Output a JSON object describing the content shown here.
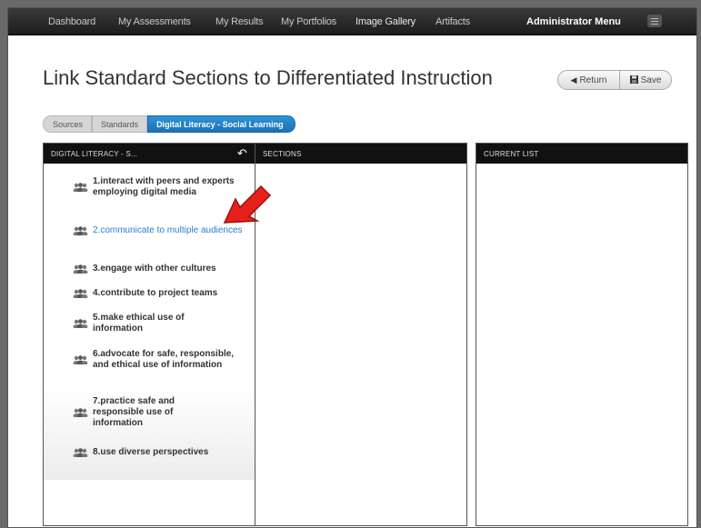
{
  "nav": {
    "items": [
      "Dashboard",
      "My Assessments",
      "My Results",
      "My Portfolios",
      "Image Gallery",
      "Artifacts"
    ],
    "admin_menu": "Administrator Menu"
  },
  "page": {
    "title": "Link Standard Sections to Differentiated Instruction",
    "return_label": "Return",
    "save_label": "Save"
  },
  "breadcrumb": [
    "Sources",
    "Standards",
    "Digital Literacy - Social Learning"
  ],
  "panels": {
    "left_header": "DIGITAL LITERACY - S...",
    "sections_header": "SECTIONS",
    "current_header": "CURRENT LIST"
  },
  "standards": [
    "1.interact with peers and experts employing digital media",
    "2.communicate to multiple audiences",
    "3.engage with other cultures",
    "4.contribute to project teams",
    "5.make ethical use of information",
    "6.advocate for safe, responsible, and ethical use of information",
    "7.practice safe and responsible use of information",
    "8.use diverse perspectives"
  ],
  "colors": {
    "accent": "#2a7fc9",
    "arrow": "#e8201c",
    "header_bg": "#111111"
  }
}
